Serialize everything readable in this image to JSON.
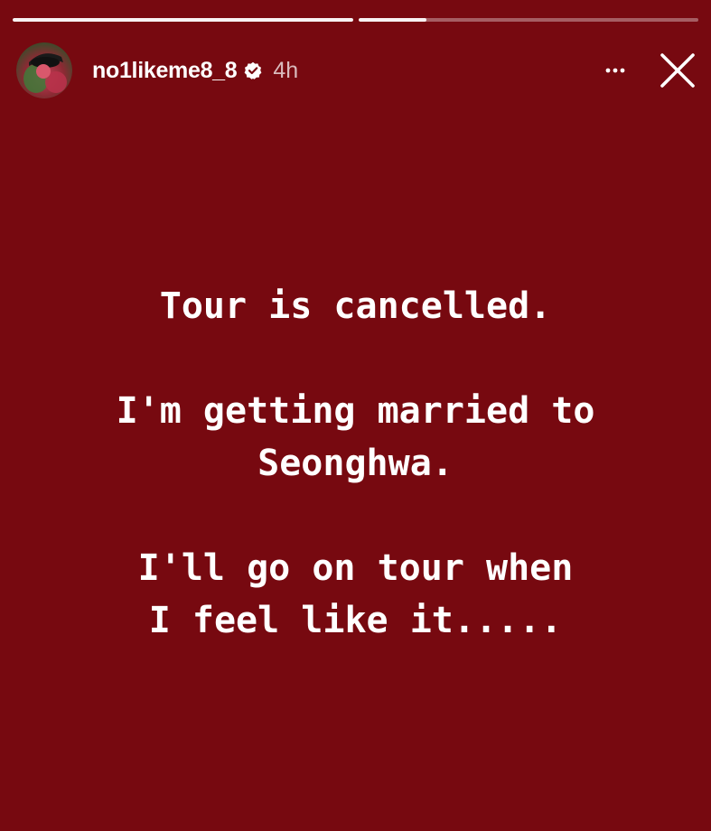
{
  "story": {
    "progress": [
      1.0,
      0.2
    ],
    "account": {
      "username": "no1likeme8_8",
      "verified": true,
      "time_ago": "4h"
    },
    "controls": {
      "more_icon": "more-horizontal-icon",
      "close_icon": "close-icon"
    },
    "text": {
      "para1_line1": "Tour is cancelled.",
      "para2_line1": "I'm getting married to",
      "para2_line2": "Seonghwa.",
      "para3_line1": "I'll go on tour when",
      "para3_line2": "I feel like it....."
    },
    "colors": {
      "background": "#770910",
      "text": "#ffffff"
    }
  }
}
